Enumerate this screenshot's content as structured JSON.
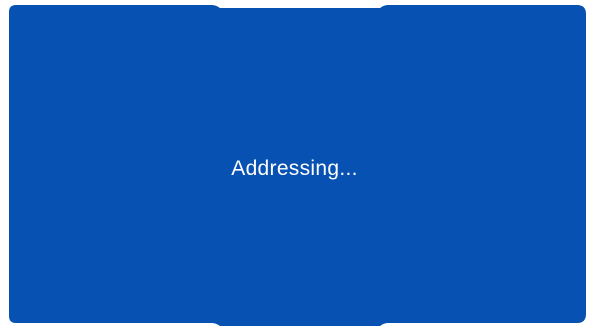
{
  "screen": {
    "status_text": "Addressing...",
    "colors": {
      "panel": "#0751b2",
      "background": "#ffffff",
      "text": "#ffffff"
    }
  }
}
